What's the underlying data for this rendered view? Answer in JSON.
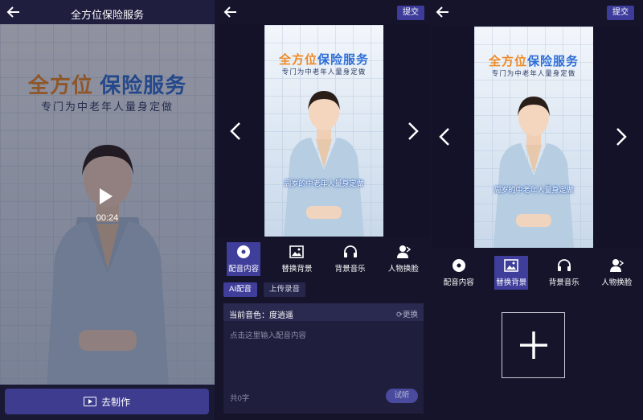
{
  "screen1": {
    "title": "全方位保险服务",
    "poster": {
      "headline_orange": "全方位",
      "headline_blue": "保险服务",
      "subline": "专门为中老年人量身定做"
    },
    "video": {
      "duration": "00:24"
    },
    "make_button": {
      "label": "去制作",
      "icon": "video-play-icon"
    }
  },
  "screen2": {
    "submit_label": "提交",
    "preview": {
      "headline_orange": "全方位",
      "headline_blue": "保险服务",
      "subline": "专门为中老年人量身定做",
      "caption": "周岁的中老年人量身定做"
    },
    "tools": [
      {
        "label": "配音内容",
        "icon": "disc-icon",
        "active": true
      },
      {
        "label": "替换背景",
        "icon": "image-icon",
        "active": false
      },
      {
        "label": "背景音乐",
        "icon": "headphones-icon",
        "active": false
      },
      {
        "label": "人物换脸",
        "icon": "user-swap-icon",
        "active": false
      }
    ],
    "modes": [
      {
        "label": "AI配音",
        "active": true
      },
      {
        "label": "上传录音",
        "active": false
      }
    ],
    "voice_label": "当前音色：度逍遥",
    "change_label": "更换",
    "input_placeholder": "点击这里输入配音内容",
    "char_count": "共0字",
    "listen_label": "试听"
  },
  "screen3": {
    "submit_label": "提交",
    "preview": {
      "headline_orange": "全方位",
      "headline_blue": "保险服务",
      "subline": "专门为中老年人量身定做",
      "caption": "周岁的中老年人量身定做"
    },
    "tools": [
      {
        "label": "配音内容",
        "icon": "disc-icon",
        "active": false
      },
      {
        "label": "替换背景",
        "icon": "image-icon",
        "active": true
      },
      {
        "label": "背景音乐",
        "icon": "headphones-icon",
        "active": false
      },
      {
        "label": "人物换脸",
        "icon": "user-swap-icon",
        "active": false
      }
    ],
    "upload_icon": "plus-icon"
  },
  "colors": {
    "background": "#15142b",
    "accent": "#3d3c9a",
    "headline_orange": "#f08a24",
    "headline_blue": "#2e6fd6"
  }
}
